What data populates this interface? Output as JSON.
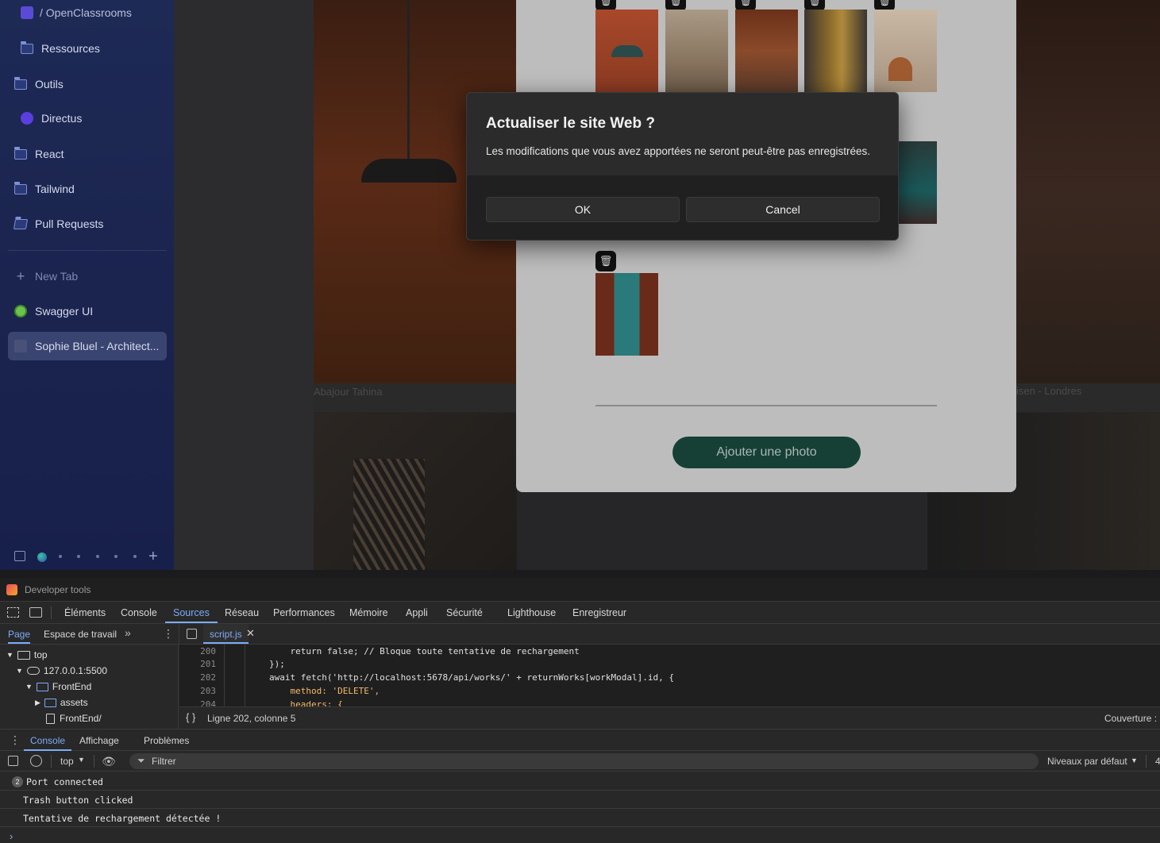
{
  "sidebar": {
    "breadcrumb": "/ OpenClassrooms",
    "items": [
      {
        "label": "Ressources",
        "icon": "folder-icon"
      },
      {
        "label": "Outils",
        "icon": "folder-icon"
      },
      {
        "label": "Directus",
        "icon": "directus-icon"
      },
      {
        "label": "React",
        "icon": "folder-icon"
      },
      {
        "label": "Tailwind",
        "icon": "folder-icon"
      },
      {
        "label": "Pull Requests",
        "icon": "folder-icon"
      }
    ],
    "new_tab": "New Tab",
    "tabs": [
      {
        "label": "Swagger UI",
        "icon": "swagger-icon"
      },
      {
        "label": "Sophie Bluel - Architect...",
        "icon": "page-icon"
      }
    ]
  },
  "page": {
    "caption_left": "Abajour Tahina",
    "caption_right": "isen - Londres",
    "add_photo_button": "Ajouter une photo"
  },
  "dialog": {
    "title": "Actualiser le site Web ?",
    "message": "Les modifications que vous avez apportées ne seront peut-être pas enregistrées.",
    "ok": "OK",
    "cancel": "Cancel"
  },
  "devtools": {
    "title": "Developer tools",
    "tabs": [
      "Éléments",
      "Console",
      "Sources",
      "Réseau",
      "Performances",
      "Mémoire",
      "Appli",
      "Sécurité",
      "Lighthouse",
      "Enregistreur"
    ],
    "selected_tab": "Sources",
    "nav_tabs": {
      "page": "Page",
      "workspace": "Espace de travail"
    },
    "file_tab": "script.js",
    "tree": {
      "top": "top",
      "host": "127.0.0.1:5500",
      "frontend": "FrontEnd",
      "assets": "assets",
      "frontend_file": "FrontEnd/"
    },
    "code_lines": [
      {
        "num": "200",
        "text": "    return false; // Bloque toute tentative de rechargement"
      },
      {
        "num": "201",
        "text": "});"
      },
      {
        "num": "202",
        "text": "await fetch('http://localhost:5678/api/works/' + returnWorks[workModal].id, {"
      },
      {
        "num": "203",
        "text": "    method: 'DELETE',"
      },
      {
        "num": "204",
        "text": "    headers: {"
      }
    ],
    "status": "Ligne 202, colonne 5",
    "coverage": "Couverture :",
    "drawer_tabs": [
      "Console",
      "Affichage",
      "Problèmes"
    ],
    "console_context": "top",
    "filter_placeholder": "Filtrer",
    "levels": "Niveaux par défaut",
    "levels_count": "4",
    "messages": [
      {
        "count": "2",
        "text": "Port connected"
      },
      {
        "text": "Trash button clicked"
      },
      {
        "text": "Tentative de rechargement détectée !"
      }
    ]
  }
}
